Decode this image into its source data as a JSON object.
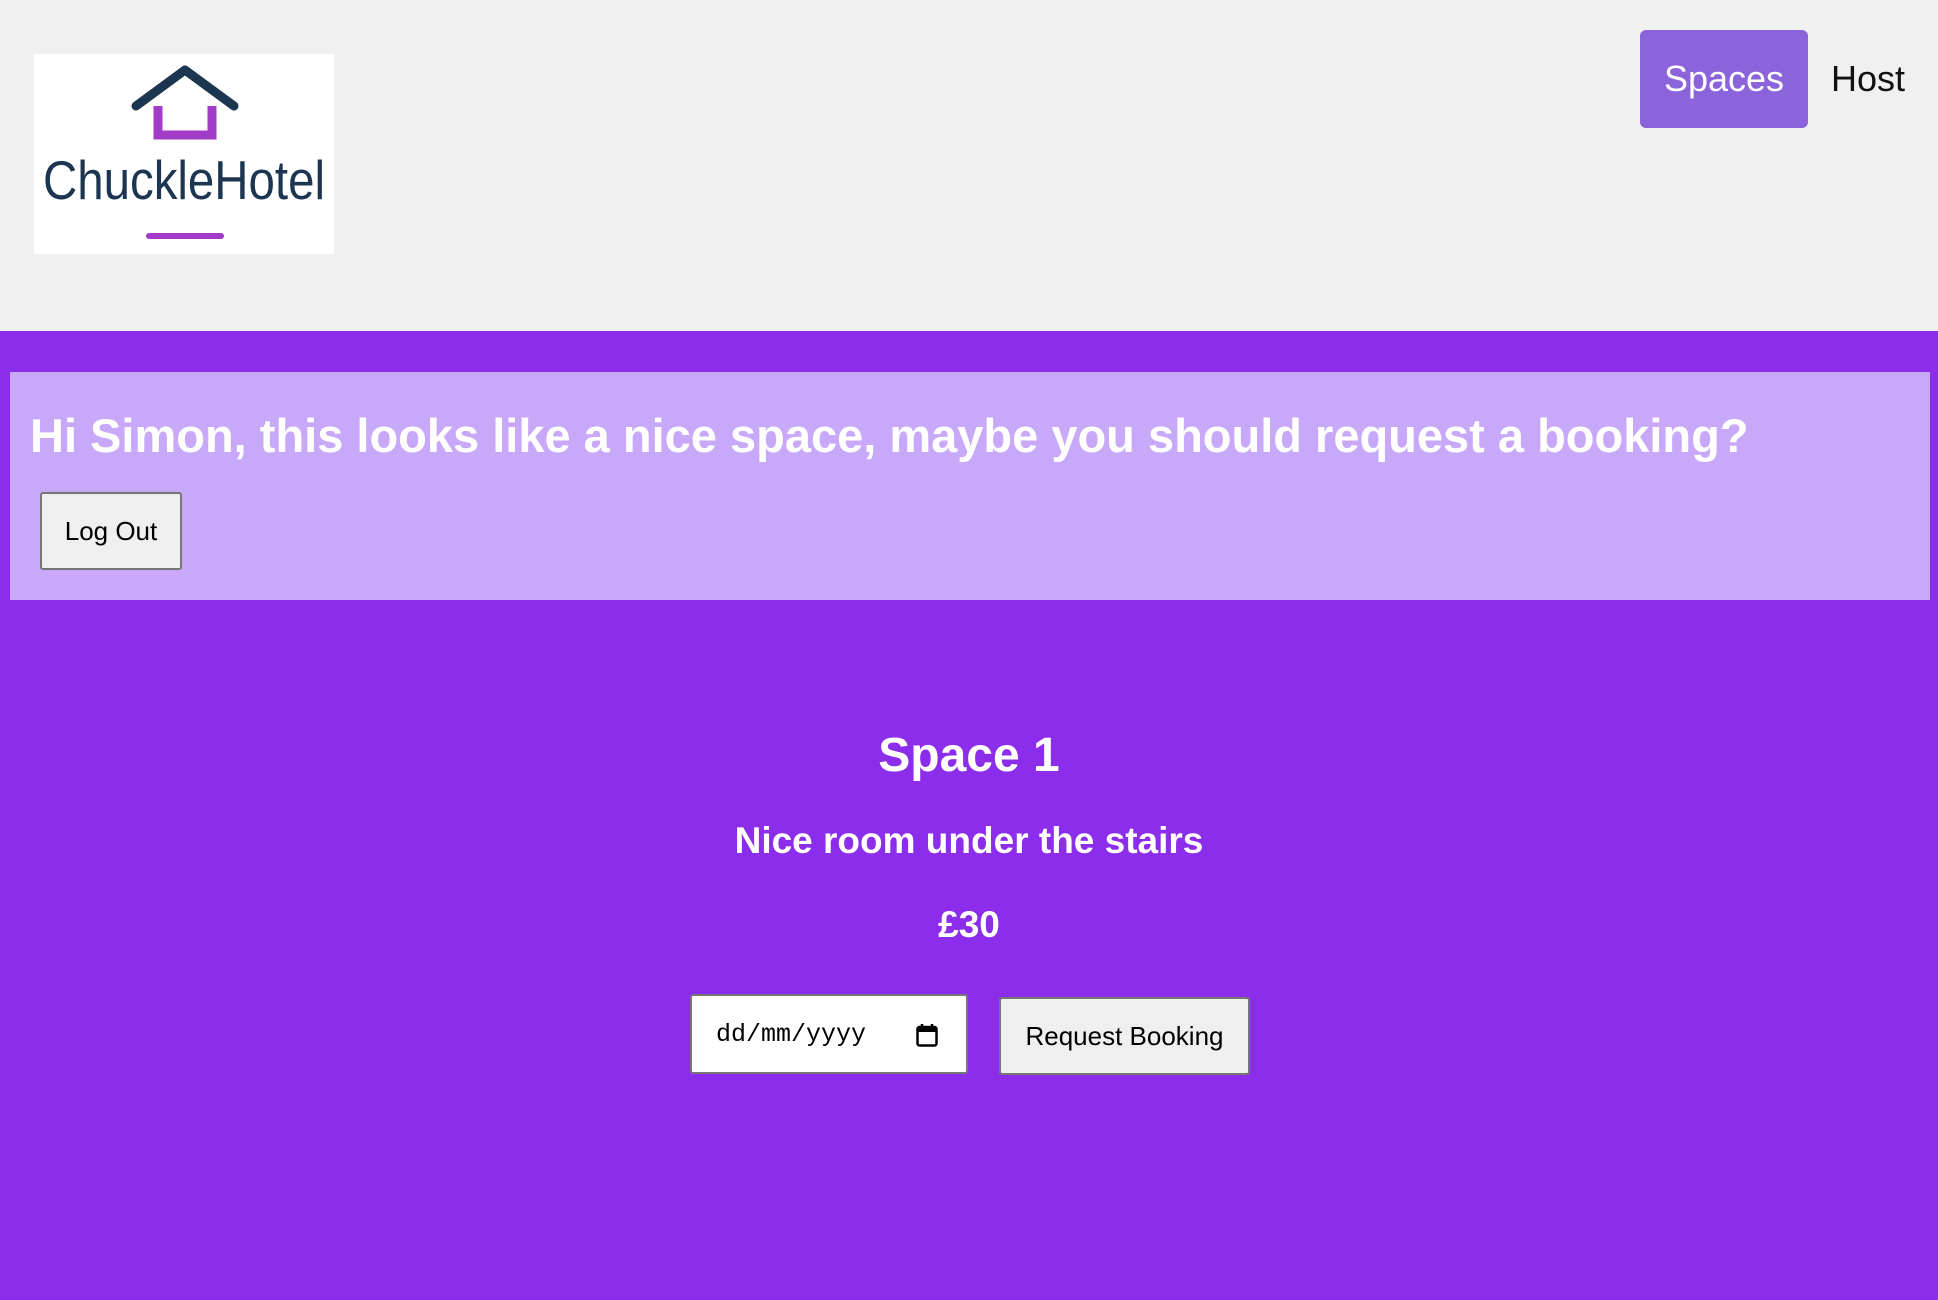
{
  "brand": {
    "name": "ChuckleHotel"
  },
  "nav": {
    "spaces_label": "Spaces",
    "host_label": "Host"
  },
  "banner": {
    "greeting": "Hi Simon, this looks like a nice space, maybe you should request a booking?",
    "logout_label": "Log Out"
  },
  "space": {
    "title": "Space 1",
    "description": "Nice room under the stairs",
    "price": "£30"
  },
  "booking": {
    "date_placeholder": "dd/mm/yyyy",
    "request_label": "Request Booking"
  },
  "icons": {
    "date": "calendar-icon",
    "logo": "house-icon"
  },
  "colors": {
    "page_background": "#8c2deb",
    "header_background": "#f0f0f0",
    "banner_background": "#c8a8f8",
    "nav_active": "#8b64db",
    "logo_navy": "#1c3550",
    "logo_magenta": "#a23cc8"
  }
}
